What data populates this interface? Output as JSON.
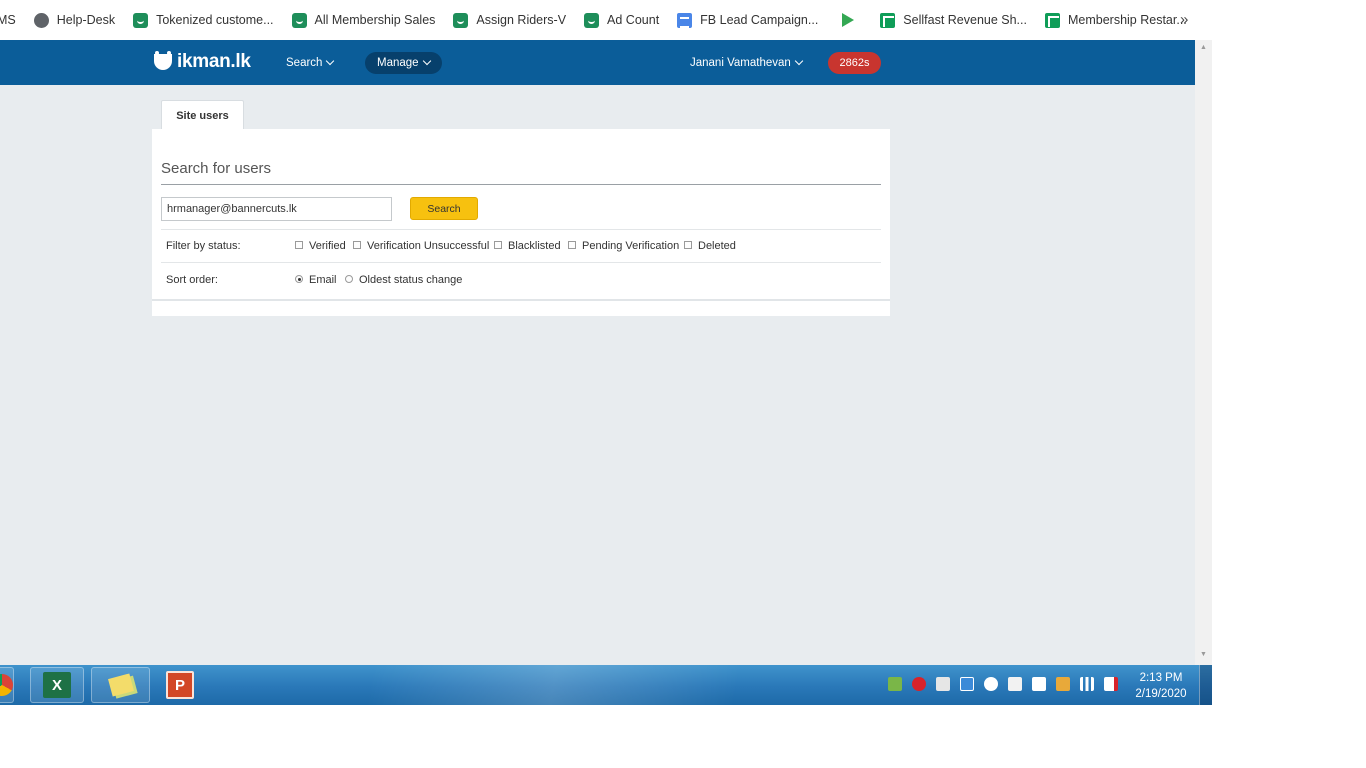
{
  "bookmarks": {
    "items": [
      {
        "label": "MS",
        "icon": "none"
      },
      {
        "label": "Help-Desk",
        "icon": "globe-icon"
      },
      {
        "label": "Tokenized custome...",
        "icon": "ikman-icon"
      },
      {
        "label": "All Membership Sales",
        "icon": "ikman-icon"
      },
      {
        "label": "Assign Riders-V",
        "icon": "ikman-icon"
      },
      {
        "label": "Ad Count",
        "icon": "ikman-icon"
      },
      {
        "label": "FB Lead Campaign...",
        "icon": "docs-icon"
      },
      {
        "label": "",
        "icon": "play-icon"
      },
      {
        "label": "Sellfast Revenue Sh...",
        "icon": "sheets-icon"
      },
      {
        "label": "Membership Restar...",
        "icon": "sheets-icon"
      }
    ],
    "more": "»"
  },
  "nav": {
    "logo": "ikman.lk",
    "search": "Search",
    "manage": "Manage",
    "user": "Janani Vamathevan",
    "badge": "2862s"
  },
  "page": {
    "tab": "Site users",
    "title": "Search for users",
    "search_value": "hrmanager@bannercuts.lk",
    "search_button": "Search",
    "filter_label": "Filter by status:",
    "filters": [
      "Verified",
      "Verification Unsuccessful",
      "Blacklisted",
      "Pending Verification",
      "Deleted"
    ],
    "sort_label": "Sort order:",
    "sort_options": [
      "Email",
      "Oldest status change"
    ],
    "sort_selected": "Email"
  },
  "taskbar": {
    "time": "2:13 PM",
    "date": "2/19/2020",
    "excel_letter": "X",
    "ppt_letter": "P"
  },
  "colors": {
    "nav_bg": "#0b5d99",
    "accent_button": "#f7c10f",
    "badge": "#c8352f"
  }
}
